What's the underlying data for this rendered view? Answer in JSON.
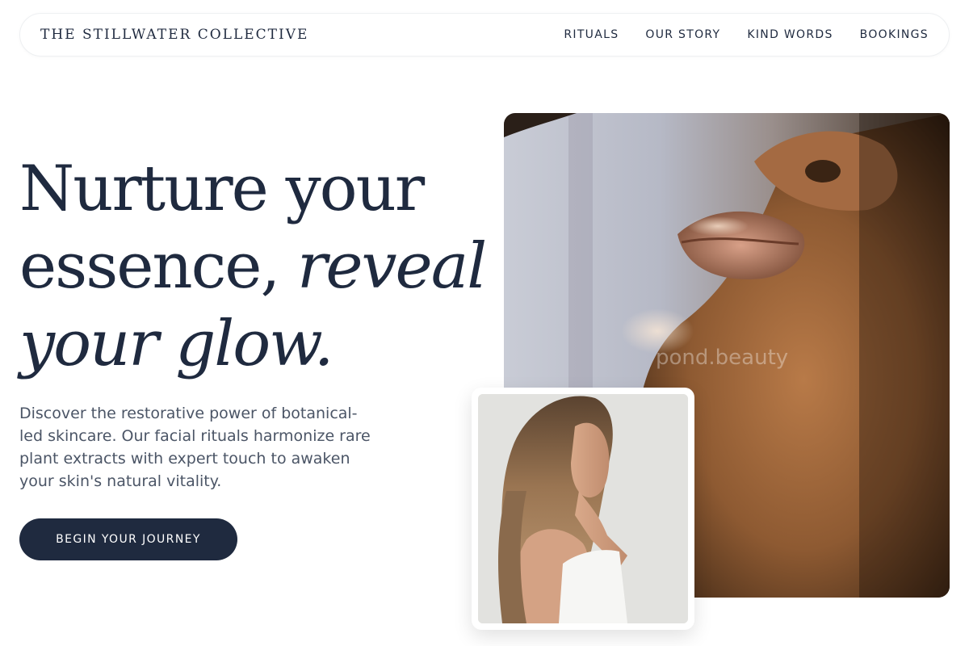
{
  "header": {
    "brand": "THE STILLWATER COLLECTIVE",
    "nav": [
      "RITUALS",
      "OUR STORY",
      "KIND WORDS",
      "BOOKINGS"
    ]
  },
  "hero": {
    "headline_line1": "Nurture your",
    "headline_line2_plain": "essence, ",
    "headline_line2_italic": "reveal",
    "headline_line3_italic": "your glow.",
    "description": "Discover the restorative power of botanical-led skincare. Our facial rituals harmonize rare plant extracts with expert touch to awaken your skin's natural vitality.",
    "cta_label": "BEGIN YOUR JOURNEY"
  },
  "images": {
    "main_watermark": "pond.beauty"
  },
  "colors": {
    "navy": "#1f2a3f",
    "body_text": "#4b5566",
    "background": "#ffffff"
  }
}
